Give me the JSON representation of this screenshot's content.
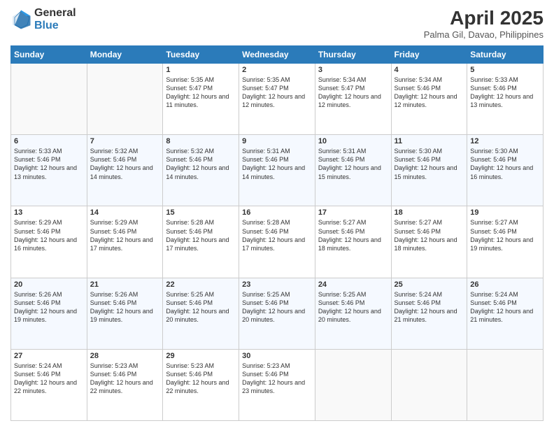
{
  "header": {
    "logo_general": "General",
    "logo_blue": "Blue",
    "title": "April 2025",
    "location": "Palma Gil, Davao, Philippines"
  },
  "weekdays": [
    "Sunday",
    "Monday",
    "Tuesday",
    "Wednesday",
    "Thursday",
    "Friday",
    "Saturday"
  ],
  "weeks": [
    [
      {
        "day": "",
        "content": ""
      },
      {
        "day": "",
        "content": ""
      },
      {
        "day": "1",
        "content": "Sunrise: 5:35 AM\nSunset: 5:47 PM\nDaylight: 12 hours and 11 minutes."
      },
      {
        "day": "2",
        "content": "Sunrise: 5:35 AM\nSunset: 5:47 PM\nDaylight: 12 hours and 12 minutes."
      },
      {
        "day": "3",
        "content": "Sunrise: 5:34 AM\nSunset: 5:47 PM\nDaylight: 12 hours and 12 minutes."
      },
      {
        "day": "4",
        "content": "Sunrise: 5:34 AM\nSunset: 5:46 PM\nDaylight: 12 hours and 12 minutes."
      },
      {
        "day": "5",
        "content": "Sunrise: 5:33 AM\nSunset: 5:46 PM\nDaylight: 12 hours and 13 minutes."
      }
    ],
    [
      {
        "day": "6",
        "content": "Sunrise: 5:33 AM\nSunset: 5:46 PM\nDaylight: 12 hours and 13 minutes."
      },
      {
        "day": "7",
        "content": "Sunrise: 5:32 AM\nSunset: 5:46 PM\nDaylight: 12 hours and 14 minutes."
      },
      {
        "day": "8",
        "content": "Sunrise: 5:32 AM\nSunset: 5:46 PM\nDaylight: 12 hours and 14 minutes."
      },
      {
        "day": "9",
        "content": "Sunrise: 5:31 AM\nSunset: 5:46 PM\nDaylight: 12 hours and 14 minutes."
      },
      {
        "day": "10",
        "content": "Sunrise: 5:31 AM\nSunset: 5:46 PM\nDaylight: 12 hours and 15 minutes."
      },
      {
        "day": "11",
        "content": "Sunrise: 5:30 AM\nSunset: 5:46 PM\nDaylight: 12 hours and 15 minutes."
      },
      {
        "day": "12",
        "content": "Sunrise: 5:30 AM\nSunset: 5:46 PM\nDaylight: 12 hours and 16 minutes."
      }
    ],
    [
      {
        "day": "13",
        "content": "Sunrise: 5:29 AM\nSunset: 5:46 PM\nDaylight: 12 hours and 16 minutes."
      },
      {
        "day": "14",
        "content": "Sunrise: 5:29 AM\nSunset: 5:46 PM\nDaylight: 12 hours and 17 minutes."
      },
      {
        "day": "15",
        "content": "Sunrise: 5:28 AM\nSunset: 5:46 PM\nDaylight: 12 hours and 17 minutes."
      },
      {
        "day": "16",
        "content": "Sunrise: 5:28 AM\nSunset: 5:46 PM\nDaylight: 12 hours and 17 minutes."
      },
      {
        "day": "17",
        "content": "Sunrise: 5:27 AM\nSunset: 5:46 PM\nDaylight: 12 hours and 18 minutes."
      },
      {
        "day": "18",
        "content": "Sunrise: 5:27 AM\nSunset: 5:46 PM\nDaylight: 12 hours and 18 minutes."
      },
      {
        "day": "19",
        "content": "Sunrise: 5:27 AM\nSunset: 5:46 PM\nDaylight: 12 hours and 19 minutes."
      }
    ],
    [
      {
        "day": "20",
        "content": "Sunrise: 5:26 AM\nSunset: 5:46 PM\nDaylight: 12 hours and 19 minutes."
      },
      {
        "day": "21",
        "content": "Sunrise: 5:26 AM\nSunset: 5:46 PM\nDaylight: 12 hours and 19 minutes."
      },
      {
        "day": "22",
        "content": "Sunrise: 5:25 AM\nSunset: 5:46 PM\nDaylight: 12 hours and 20 minutes."
      },
      {
        "day": "23",
        "content": "Sunrise: 5:25 AM\nSunset: 5:46 PM\nDaylight: 12 hours and 20 minutes."
      },
      {
        "day": "24",
        "content": "Sunrise: 5:25 AM\nSunset: 5:46 PM\nDaylight: 12 hours and 20 minutes."
      },
      {
        "day": "25",
        "content": "Sunrise: 5:24 AM\nSunset: 5:46 PM\nDaylight: 12 hours and 21 minutes."
      },
      {
        "day": "26",
        "content": "Sunrise: 5:24 AM\nSunset: 5:46 PM\nDaylight: 12 hours and 21 minutes."
      }
    ],
    [
      {
        "day": "27",
        "content": "Sunrise: 5:24 AM\nSunset: 5:46 PM\nDaylight: 12 hours and 22 minutes."
      },
      {
        "day": "28",
        "content": "Sunrise: 5:23 AM\nSunset: 5:46 PM\nDaylight: 12 hours and 22 minutes."
      },
      {
        "day": "29",
        "content": "Sunrise: 5:23 AM\nSunset: 5:46 PM\nDaylight: 12 hours and 22 minutes."
      },
      {
        "day": "30",
        "content": "Sunrise: 5:23 AM\nSunset: 5:46 PM\nDaylight: 12 hours and 23 minutes."
      },
      {
        "day": "",
        "content": ""
      },
      {
        "day": "",
        "content": ""
      },
      {
        "day": "",
        "content": ""
      }
    ]
  ]
}
